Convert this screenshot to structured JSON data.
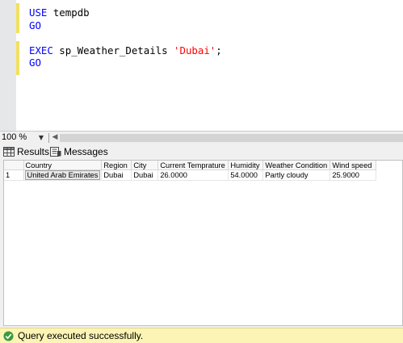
{
  "editor": {
    "lines": [
      [
        {
          "text": "USE",
          "kind": "keyword"
        },
        {
          "text": " tempdb",
          "kind": "plain"
        }
      ],
      [
        {
          "text": "GO",
          "kind": "keyword"
        }
      ],
      [],
      [
        {
          "text": "EXEC",
          "kind": "keyword"
        },
        {
          "text": " sp_Weather_Details ",
          "kind": "plain"
        },
        {
          "text": "'Dubai'",
          "kind": "string"
        },
        {
          "text": ";",
          "kind": "plain"
        }
      ],
      [
        {
          "text": "GO",
          "kind": "keyword"
        }
      ]
    ],
    "colors": {
      "keyword": "#0000ff",
      "string": "#ff0000",
      "plain": "#000000",
      "change_bar": "#f0e060"
    }
  },
  "zoom": {
    "value": "100 %"
  },
  "tabs": {
    "results_label": "Results",
    "messages_label": "Messages",
    "results_icon": "grid-icon",
    "messages_icon": "messages-icon"
  },
  "grid": {
    "columns": [
      "Country",
      "Region",
      "City",
      "Current Temprature",
      "Humidity",
      "Weather Condition",
      "Wind speed"
    ],
    "rows": [
      {
        "num": "1",
        "cells": [
          "United Arab Emirates",
          "Dubai",
          "Dubai",
          "26.0000",
          "54.0000",
          "Partly cloudy",
          "25.9000"
        ]
      }
    ]
  },
  "status": {
    "text": "Query executed successfully.",
    "icon": "success-check-icon",
    "background": "#fcf4b4"
  }
}
